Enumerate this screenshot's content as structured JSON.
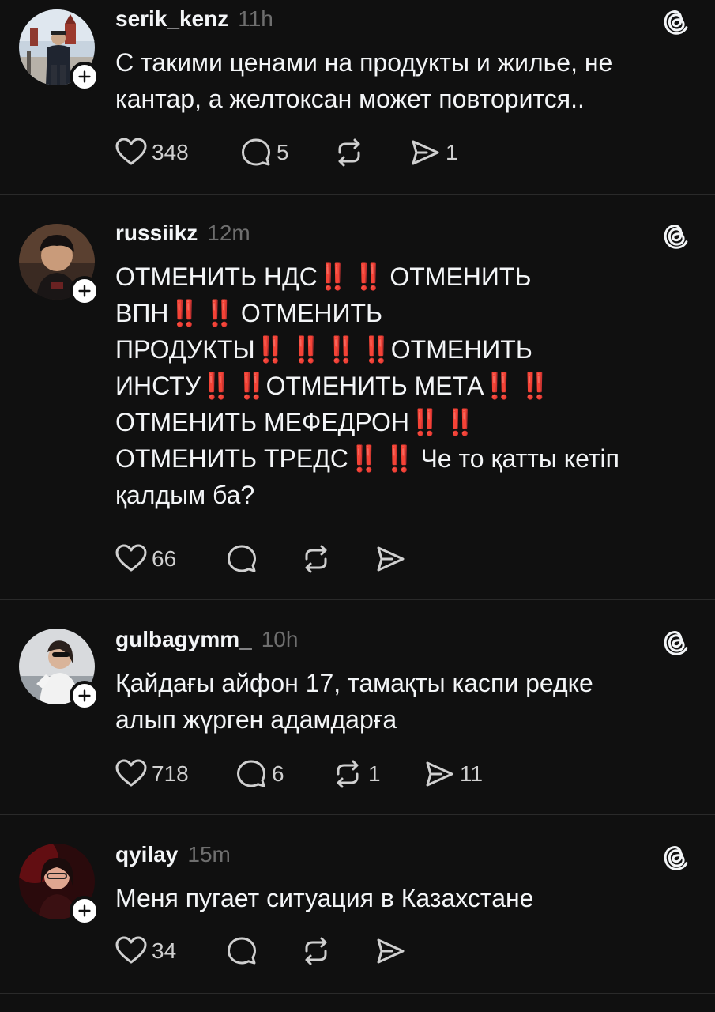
{
  "posts": [
    {
      "username": "serik_kenz",
      "time": "11h",
      "text": "С такими ценами на продукты и жилье, не\nкантар, а желтоксан может повторится..",
      "likes": "348",
      "replies": "5",
      "reposts": "",
      "shares": "1",
      "avatar_icon": "profile-photo-man-red-square"
    },
    {
      "username": "russiikz",
      "time": "12m",
      "text_parts": [
        "ОТМЕНИТЬ НДС",
        "‼️ ‼️",
        " ОТМЕНИТЬ\nВПН",
        "‼️ ‼️",
        " ОТМЕНИТЬ\nПРОДУКТЫ",
        "‼️ ‼️ ‼️ ‼️",
        "ОТМЕНИТЬ\nИНСТУ",
        "‼️ ‼️",
        "ОТМЕНИТЬ МЕТА",
        "‼️ ‼️",
        "\nОТМЕНИТЬ МЕФЕДРОН",
        "‼️ ‼️",
        "\nОТМЕНИТЬ ТРЕДС",
        "‼️ ‼️",
        " Че то қатты кетіп\nқалдым ба?"
      ],
      "likes": "66",
      "replies": "",
      "reposts": "",
      "shares": "",
      "avatar_icon": "profile-photo-boy"
    },
    {
      "username": "gulbagymm_",
      "time": "10h",
      "text": "Қайдағы айфон 17, тамақты каспи редке\nалып жүрген адамдарға",
      "likes": "718",
      "replies": "6",
      "reposts": "1",
      "shares": "11",
      "avatar_icon": "profile-photo-woman-sunglasses"
    },
    {
      "username": "qyilay",
      "time": "15m",
      "text": "Меня пугает ситуация в Казахстане",
      "likes": "34",
      "replies": "",
      "reposts": "",
      "shares": "",
      "avatar_icon": "profile-photo-woman-red-light"
    }
  ],
  "colors": {
    "background": "#101010",
    "text": "#f3f5f7",
    "muted": "#6e6e6e",
    "divider": "#2a2a2a",
    "emoji_red": "#e0242b"
  }
}
